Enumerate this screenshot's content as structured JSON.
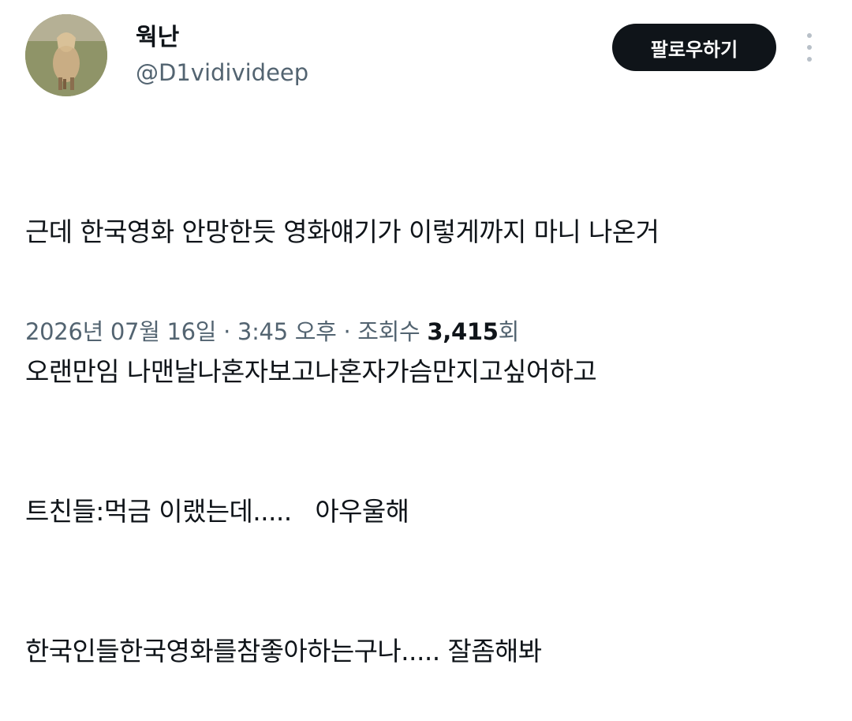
{
  "author": {
    "display_name": "웍난",
    "handle": "@D1vidivideep"
  },
  "actions": {
    "follow_label": "팔로우하기",
    "more_icon": "vertical-ellipsis-icon"
  },
  "tweet": {
    "lines": [
      "근데 한국영화 안망한듯 영화얘기가 이렇게까지 마니 나온거",
      "오랜만임 나맨날나혼자보고나혼자가슴만지고싶어하고",
      "트친들:먹금 이랬는데.....   아우울해",
      "한국인들한국영화를참좋아하는구나..... 잘좀해봐"
    ]
  },
  "meta": {
    "datetime": "2026년 07월 16일 · 3:45 오후 · 조회수 ",
    "views_count": "3,415",
    "views_unit": "회"
  },
  "colors": {
    "text": "#0f1419",
    "secondary_text": "#536471",
    "follow_button_bg": "#0f1419"
  }
}
